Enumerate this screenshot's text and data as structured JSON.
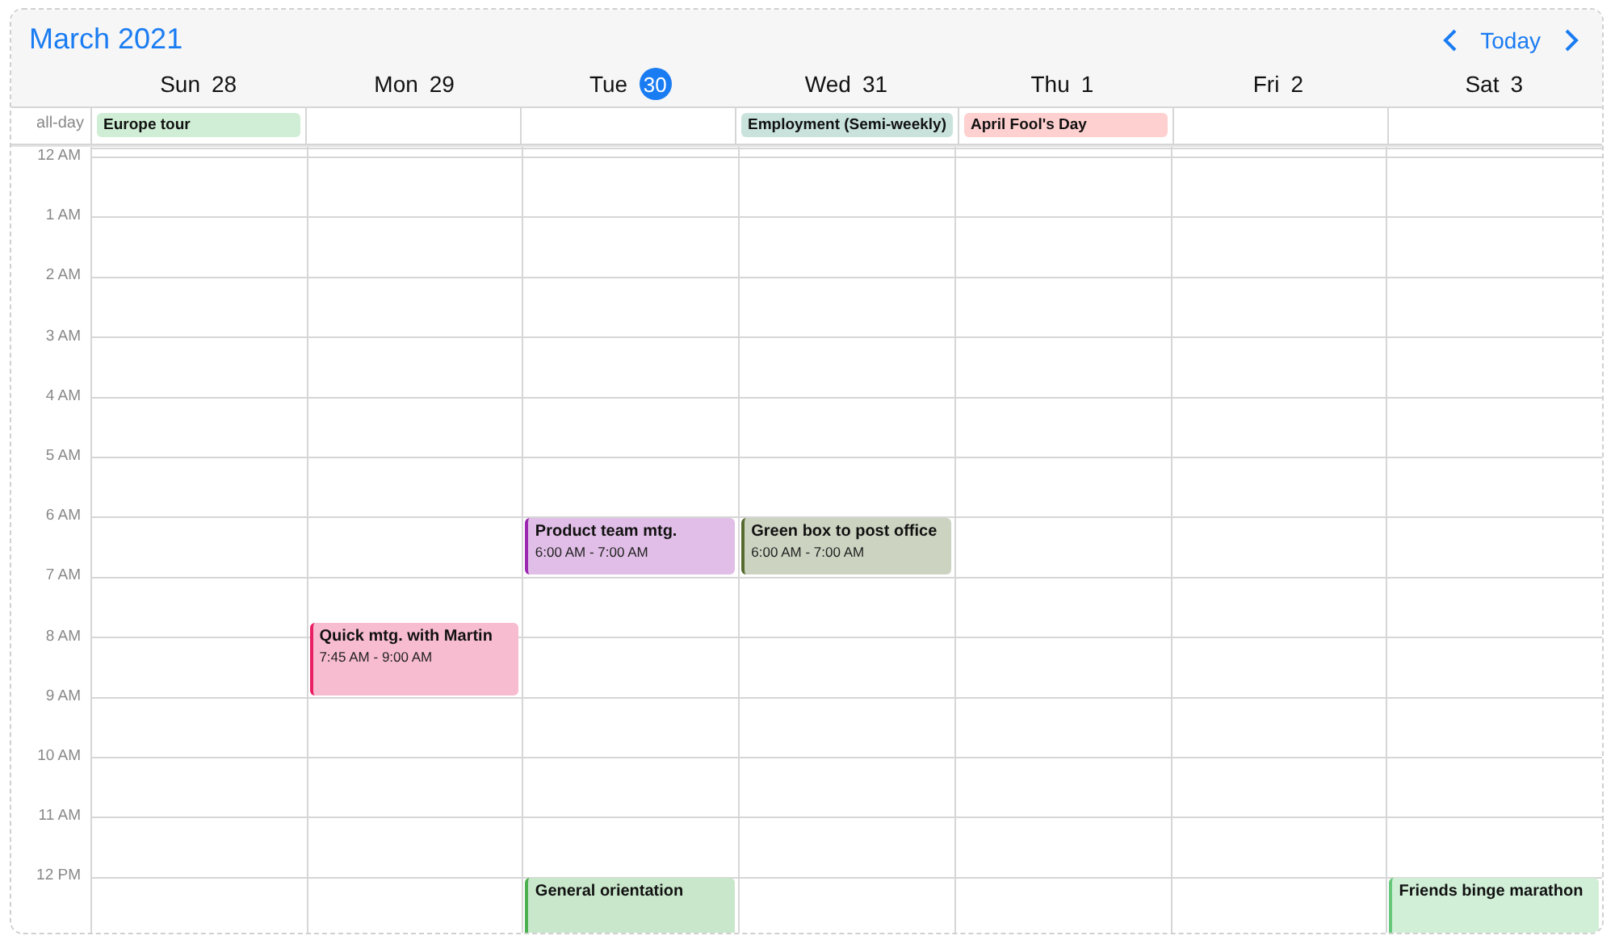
{
  "header": {
    "month": "March",
    "year": "2021",
    "today_label": "Today"
  },
  "all_day_label": "all-day",
  "days": [
    {
      "name": "Sun",
      "date": "28",
      "selected": false,
      "all_day": [
        {
          "title": "Europe tour",
          "color": "#cfeed5"
        }
      ]
    },
    {
      "name": "Mon",
      "date": "29",
      "selected": false,
      "events": [
        {
          "title": "Quick mtg. with Martin",
          "time": "7:45 AM - 9:00 AM",
          "color": "#e91e63"
        }
      ]
    },
    {
      "name": "Tue",
      "date": "30",
      "selected": true,
      "events": [
        {
          "title": "Product team mtg.",
          "time": "6:00 AM - 7:00 AM",
          "color": "#9c27b0"
        },
        {
          "title": "General orientation",
          "color": "#4caf50"
        }
      ]
    },
    {
      "name": "Wed",
      "date": "31",
      "selected": false,
      "all_day": [
        {
          "title": "Employment (Semi-weekly)",
          "color": "#c9e3dc"
        }
      ],
      "events": [
        {
          "title": "Green box to post office",
          "time": "6:00 AM - 7:00 AM",
          "color": "#556b2f"
        }
      ]
    },
    {
      "name": "Thu",
      "date": "1",
      "selected": false,
      "all_day": [
        {
          "title": "April Fool's Day",
          "color": "#ffd0d0"
        }
      ]
    },
    {
      "name": "Fri",
      "date": "2",
      "selected": false
    },
    {
      "name": "Sat",
      "date": "3",
      "selected": false,
      "events": [
        {
          "title": "Friends binge marathon",
          "color": "#66c87a"
        }
      ]
    }
  ],
  "hours": [
    "12 AM",
    "1 AM",
    "2 AM",
    "3 AM",
    "4 AM",
    "5 AM",
    "6 AM",
    "7 AM",
    "8 AM",
    "9 AM",
    "10 AM",
    "11 AM",
    "12 PM"
  ]
}
